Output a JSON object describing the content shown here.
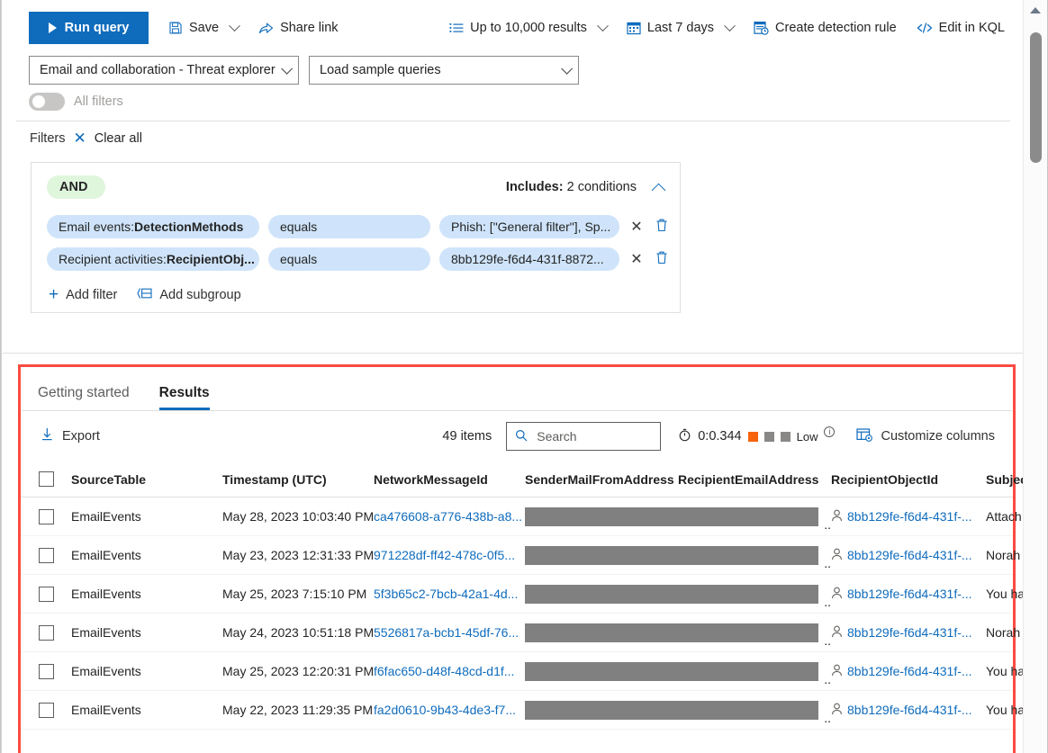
{
  "toolbar": {
    "run_query": "Run query",
    "save": "Save",
    "share_link": "Share link",
    "results_limit": "Up to 10,000 results",
    "time_range": "Last 7 days",
    "create_detection_rule": "Create detection rule",
    "edit_in_kql": "Edit in KQL",
    "icons": {
      "run": "play-icon",
      "save": "save-icon",
      "share": "share-icon",
      "list": "list-icon",
      "calendar": "calendar-icon",
      "rule": "detection-rule-icon",
      "kql": "code-icon"
    }
  },
  "selectors": {
    "schema": "Email and collaboration - Threat explorer",
    "sample_queries": "Load sample queries"
  },
  "all_filters": {
    "label": "All filters",
    "enabled": false
  },
  "filters": {
    "title": "Filters",
    "clear_all": "Clear all",
    "group": {
      "operator": "AND",
      "includes_label": "Includes:",
      "includes_value": "2 conditions",
      "conditions": [
        {
          "field_prefix": "Email events: ",
          "field_name": "DetectionMethods",
          "operator": "equals",
          "value": "Phish: [\"General filter\"], Sp..."
        },
        {
          "field_prefix": "Recipient activities: ",
          "field_name": "RecipientObj...",
          "operator": "equals",
          "value": "8bb129fe-f6d4-431f-8872..."
        }
      ],
      "add_filter": "Add filter",
      "add_subgroup": "Add subgroup"
    }
  },
  "results": {
    "tabs": [
      {
        "label": "Getting started",
        "active": false
      },
      {
        "label": "Results",
        "active": true
      }
    ],
    "export": "Export",
    "items_count": "49 items",
    "search_placeholder": "Search",
    "search_value": "",
    "perf_time": "0:0.344",
    "perf_level": "Low",
    "customize_columns": "Customize columns",
    "accent_color": "#0f6cbd",
    "perf_on_color": "#f7630c",
    "perf_off_color": "#8a8886",
    "highlight_color": "#fa4b42",
    "table": {
      "columns": [
        "SourceTable",
        "Timestamp (UTC)",
        "NetworkMessageId",
        "SenderMailFromAddress",
        "RecipientEmailAddress",
        "RecipientObjectId",
        "Subject"
      ],
      "rows": [
        {
          "source_table": "EmailEvents",
          "timestamp": "May 28, 2023 10:03:40 PM",
          "network_message_id": "ca476608-a776-438b-a8...",
          "sender_mail_from_address": "",
          "recipient_email_address": "",
          "recipient_object_id": "8bb129fe-f6d4-431f-...",
          "subject": "Attach"
        },
        {
          "source_table": "EmailEvents",
          "timestamp": "May 23, 2023 12:31:33 PM",
          "network_message_id": "971228df-ff42-478c-0f5...",
          "sender_mail_from_address": "",
          "recipient_email_address": "",
          "recipient_object_id": "8bb129fe-f6d4-431f-...",
          "subject": "Norah"
        },
        {
          "source_table": "EmailEvents",
          "timestamp": "May 25, 2023 7:15:10 PM",
          "network_message_id": "5f3b65c2-7bcb-42a1-4d...",
          "sender_mail_from_address": "",
          "recipient_email_address": "",
          "recipient_object_id": "8bb129fe-f6d4-431f-...",
          "subject": "You ha"
        },
        {
          "source_table": "EmailEvents",
          "timestamp": "May 24, 2023 10:51:18 PM",
          "network_message_id": "5526817a-bcb1-45df-76...",
          "sender_mail_from_address": "",
          "recipient_email_address": "",
          "recipient_object_id": "8bb129fe-f6d4-431f-...",
          "subject": "Norah"
        },
        {
          "source_table": "EmailEvents",
          "timestamp": "May 25, 2023 12:20:31 PM",
          "network_message_id": "f6fac650-d48f-48cd-d1f...",
          "sender_mail_from_address": "",
          "recipient_email_address": "",
          "recipient_object_id": "8bb129fe-f6d4-431f-...",
          "subject": "You ha"
        },
        {
          "source_table": "EmailEvents",
          "timestamp": "May 22, 2023 11:29:35 PM",
          "network_message_id": "fa2d0610-9b43-4de3-f7...",
          "sender_mail_from_address": "",
          "recipient_email_address": "",
          "recipient_object_id": "8bb129fe-f6d4-431f-...",
          "subject": "You ha"
        }
      ],
      "truncation_marker": ".."
    }
  }
}
